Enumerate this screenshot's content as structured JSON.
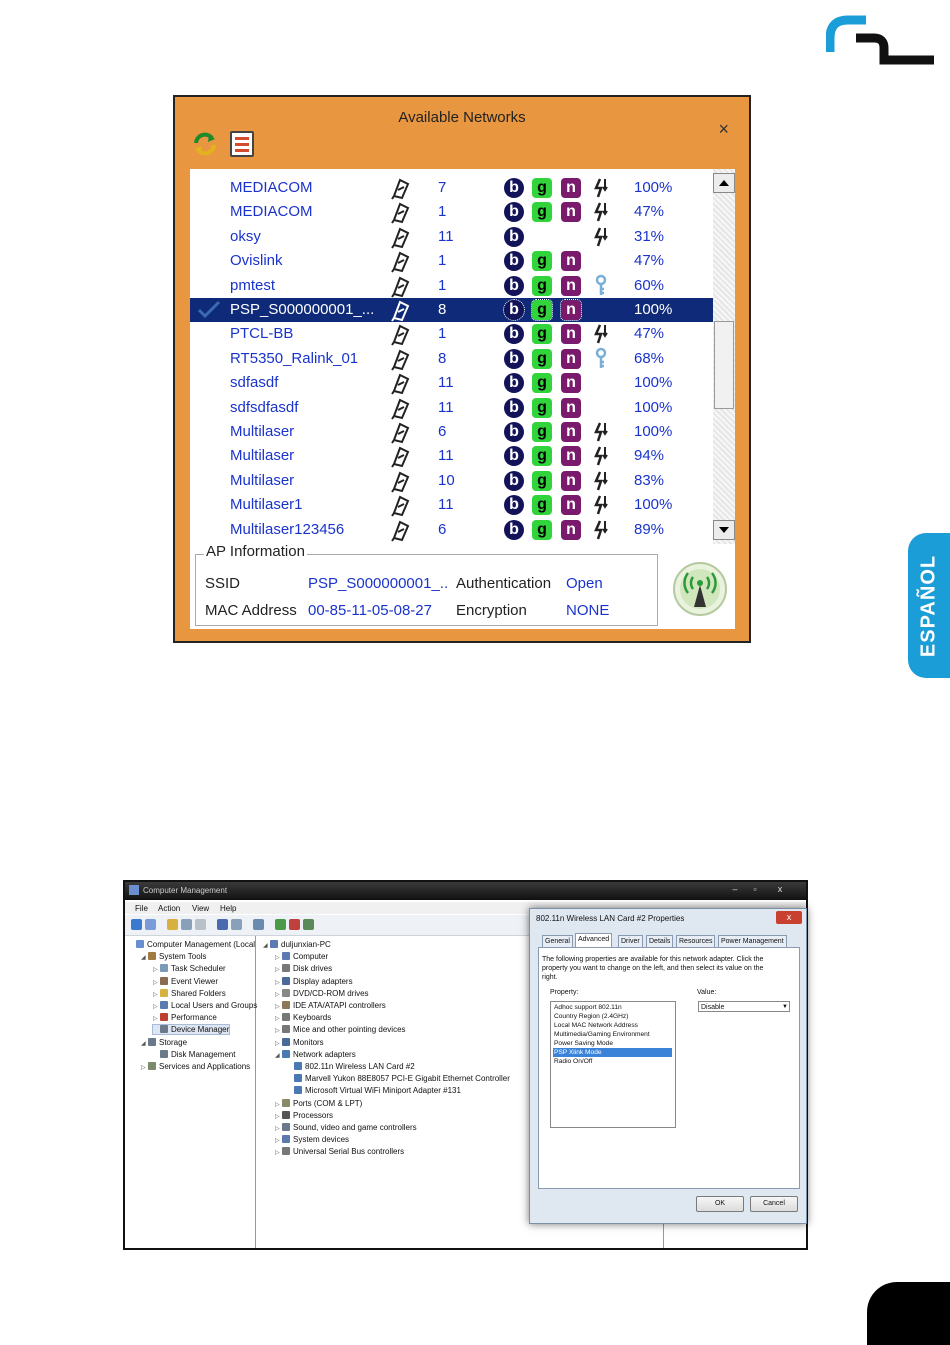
{
  "side_tab": {
    "label": "ESPAÑOL"
  },
  "available_networks": {
    "title": "Available Networks",
    "close_glyph": "×",
    "networks": [
      {
        "ssid": "MEDIACOM",
        "channel": "7",
        "b": "b",
        "g": "g",
        "n": "n",
        "mode": "adhoc",
        "signal": "100%"
      },
      {
        "ssid": "MEDIACOM",
        "channel": "1",
        "b": "b",
        "g": "g",
        "n": "n",
        "mode": "adhoc",
        "signal": "47%"
      },
      {
        "ssid": "oksy",
        "channel": "11",
        "b": "b",
        "g": "",
        "n": "",
        "mode": "adhoc",
        "signal": "31%"
      },
      {
        "ssid": "Ovislink",
        "channel": "1",
        "b": "b",
        "g": "g",
        "n": "n",
        "mode": "",
        "signal": "47%"
      },
      {
        "ssid": "pmtest",
        "channel": "1",
        "b": "b",
        "g": "g",
        "n": "n",
        "mode": "key",
        "signal": "60%"
      },
      {
        "ssid": "PSP_S000000001_...",
        "channel": "8",
        "b": "b",
        "g": "g",
        "n": "n",
        "mode": "",
        "signal": "100%",
        "selected": true,
        "connected": true
      },
      {
        "ssid": "PTCL-BB",
        "channel": "1",
        "b": "b",
        "g": "g",
        "n": "n",
        "mode": "adhoc",
        "signal": "47%"
      },
      {
        "ssid": "RT5350_Ralink_01",
        "channel": "8",
        "b": "b",
        "g": "g",
        "n": "n",
        "mode": "key",
        "signal": "68%"
      },
      {
        "ssid": "sdfasdf",
        "channel": "11",
        "b": "b",
        "g": "g",
        "n": "n",
        "mode": "",
        "signal": "100%"
      },
      {
        "ssid": "sdfsdfasdf",
        "channel": "11",
        "b": "b",
        "g": "g",
        "n": "n",
        "mode": "",
        "signal": "100%"
      },
      {
        "ssid": "Multilaser",
        "channel": "6",
        "b": "b",
        "g": "g",
        "n": "n",
        "mode": "adhoc",
        "signal": "100%"
      },
      {
        "ssid": "Multilaser",
        "channel": "11",
        "b": "b",
        "g": "g",
        "n": "n",
        "mode": "adhoc",
        "signal": "94%"
      },
      {
        "ssid": "Multilaser",
        "channel": "10",
        "b": "b",
        "g": "g",
        "n": "n",
        "mode": "adhoc",
        "signal": "83%"
      },
      {
        "ssid": "Multilaser1",
        "channel": "11",
        "b": "b",
        "g": "g",
        "n": "n",
        "mode": "adhoc",
        "signal": "100%"
      },
      {
        "ssid": "Multilaser123456",
        "channel": "6",
        "b": "b",
        "g": "g",
        "n": "n",
        "mode": "adhoc",
        "signal": "89%"
      }
    ],
    "ap_info": {
      "legend": "AP Information",
      "ssid_label": "SSID",
      "ssid_value": "PSP_S000000001_..",
      "auth_label": "Authentication",
      "auth_value": "Open",
      "mac_label": "MAC Address",
      "mac_value": "00-85-11-05-08-27",
      "enc_label": "Encryption",
      "enc_value": "NONE"
    }
  },
  "computer_management": {
    "title": "Computer Management",
    "window_buttons": [
      "–",
      "▫",
      "x"
    ],
    "menu": [
      "File",
      "Action",
      "View",
      "Help"
    ],
    "left_tree": [
      {
        "label": "Computer Management (Local",
        "indent": 0,
        "twisty": "",
        "color": "#6a8ed0"
      },
      {
        "label": "System Tools",
        "indent": 1,
        "twisty": "◢",
        "color": "#a07a40"
      },
      {
        "label": "Task Scheduler",
        "indent": 2,
        "twisty": "▷",
        "color": "#7a9ab8"
      },
      {
        "label": "Event Viewer",
        "indent": 2,
        "twisty": "▷",
        "color": "#8a6a50"
      },
      {
        "label": "Shared Folders",
        "indent": 2,
        "twisty": "▷",
        "color": "#d8b040"
      },
      {
        "label": "Local Users and Groups",
        "indent": 2,
        "twisty": "▷",
        "color": "#5a7ab0"
      },
      {
        "label": "Performance",
        "indent": 2,
        "twisty": "▷",
        "color": "#c04030"
      },
      {
        "label": "Device Manager",
        "indent": 2,
        "twisty": "",
        "color": "#6a7a8a",
        "selected": true
      },
      {
        "label": "Storage",
        "indent": 1,
        "twisty": "◢",
        "color": "#6a7a8a"
      },
      {
        "label": "Disk Management",
        "indent": 2,
        "twisty": "",
        "color": "#6a7a8a"
      },
      {
        "label": "Services and Applications",
        "indent": 1,
        "twisty": "▷",
        "color": "#7a8a6a"
      }
    ],
    "device_tree": [
      {
        "label": "duljunxian-PC",
        "indent": 0,
        "twisty": "◢",
        "color": "#5a7ab0"
      },
      {
        "label": "Computer",
        "indent": 1,
        "twisty": "▷",
        "color": "#5a7ab0"
      },
      {
        "label": "Disk drives",
        "indent": 1,
        "twisty": "▷",
        "color": "#777"
      },
      {
        "label": "Display adapters",
        "indent": 1,
        "twisty": "▷",
        "color": "#4a6a9a"
      },
      {
        "label": "DVD/CD-ROM drives",
        "indent": 1,
        "twisty": "▷",
        "color": "#888"
      },
      {
        "label": "IDE ATA/ATAPI controllers",
        "indent": 1,
        "twisty": "▷",
        "color": "#8a7a5a"
      },
      {
        "label": "Keyboards",
        "indent": 1,
        "twisty": "▷",
        "color": "#777"
      },
      {
        "label": "Mice and other pointing devices",
        "indent": 1,
        "twisty": "▷",
        "color": "#777"
      },
      {
        "label": "Monitors",
        "indent": 1,
        "twisty": "▷",
        "color": "#4a6a9a"
      },
      {
        "label": "Network adapters",
        "indent": 1,
        "twisty": "◢",
        "color": "#4a7ab0"
      },
      {
        "label": "802.11n Wireless LAN Card #2",
        "indent": 2,
        "twisty": "",
        "color": "#4a7ab0"
      },
      {
        "label": "Marvell Yukon 88E8057 PCI-E Gigabit Ethernet Controller",
        "indent": 2,
        "twisty": "",
        "color": "#4a7ab0"
      },
      {
        "label": "Microsoft Virtual WiFi Miniport Adapter #131",
        "indent": 2,
        "twisty": "",
        "color": "#4a7ab0"
      },
      {
        "label": "Ports (COM & LPT)",
        "indent": 1,
        "twisty": "▷",
        "color": "#8a8a6a"
      },
      {
        "label": "Processors",
        "indent": 1,
        "twisty": "▷",
        "color": "#555"
      },
      {
        "label": "Sound, video and game controllers",
        "indent": 1,
        "twisty": "▷",
        "color": "#6a7a8a"
      },
      {
        "label": "System devices",
        "indent": 1,
        "twisty": "▷",
        "color": "#5a7ab0"
      },
      {
        "label": "Universal Serial Bus controllers",
        "indent": 1,
        "twisty": "▷",
        "color": "#777"
      }
    ]
  },
  "properties_dialog": {
    "title": "802.11n Wireless LAN Card #2 Properties",
    "close_glyph": "x",
    "tabs": [
      "General",
      "Advanced",
      "Driver",
      "Details",
      "Resources",
      "Power Management"
    ],
    "active_tab": "Advanced",
    "description": "The following properties are available for this network adapter. Click the property you want to change on the left, and then select its value on the right.",
    "property_label": "Property:",
    "value_label": "Value:",
    "properties": [
      {
        "label": "Adhoc support 802.11n",
        "selected": false
      },
      {
        "label": "Country Region (2.4GHz)",
        "selected": false
      },
      {
        "label": "Local MAC Network Address",
        "selected": false
      },
      {
        "label": "Multimedia/Gaming Environment",
        "selected": false
      },
      {
        "label": "Power Saving Mode",
        "selected": false
      },
      {
        "label": "PSP Xlink Mode",
        "selected": true
      },
      {
        "label": "Radio On/Off",
        "selected": false
      }
    ],
    "value": "Disable",
    "ok_label": "OK",
    "cancel_label": "Cancel"
  },
  "colors": {
    "window_orange": "#e8963f",
    "ssid_blue": "#1a33cc",
    "selection_navy": "#0e2a78",
    "tab_blue": "#1b9ed8"
  },
  "icons": {
    "refresh": "refresh-icon",
    "list": "list-icon",
    "security": "security-icon",
    "adhoc": "adhoc-mode-icon",
    "key": "key-icon",
    "connected": "connected-check-icon",
    "wifi": "wifi-tower-icon"
  }
}
